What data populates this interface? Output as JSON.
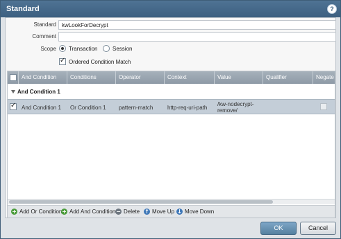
{
  "window": {
    "title": "Standard"
  },
  "form": {
    "standard_label": "Standard",
    "standard_value": "kwLookForDecrypt",
    "comment_label": "Comment",
    "comment_value": "",
    "scope_label": "Scope",
    "scope_options": [
      "Transaction",
      "Session"
    ],
    "scope_selected": "Transaction",
    "ordered_label": "Ordered Condition Match",
    "ordered_checked": true
  },
  "grid": {
    "columns": [
      "And Condition",
      "Conditions",
      "Operator",
      "Context",
      "Value",
      "Qualifier",
      "Negate"
    ],
    "group_label": "And Condition 1",
    "rows": [
      {
        "checked": true,
        "and_condition": "And Condition 1",
        "conditions": "Or Condition 1",
        "operator": "pattern-match",
        "context": "http-req-uri-path",
        "value_line1": "/kw-nodecrypt-",
        "value_line2": "remove/",
        "qualifier": "",
        "negate": false
      }
    ]
  },
  "toolbar": {
    "add_or": "Add Or Condition",
    "add_and": "Add And Condition",
    "delete": "Delete",
    "move_up": "Move Up",
    "move_down": "Move Down"
  },
  "buttons": {
    "ok": "OK",
    "cancel": "Cancel"
  }
}
